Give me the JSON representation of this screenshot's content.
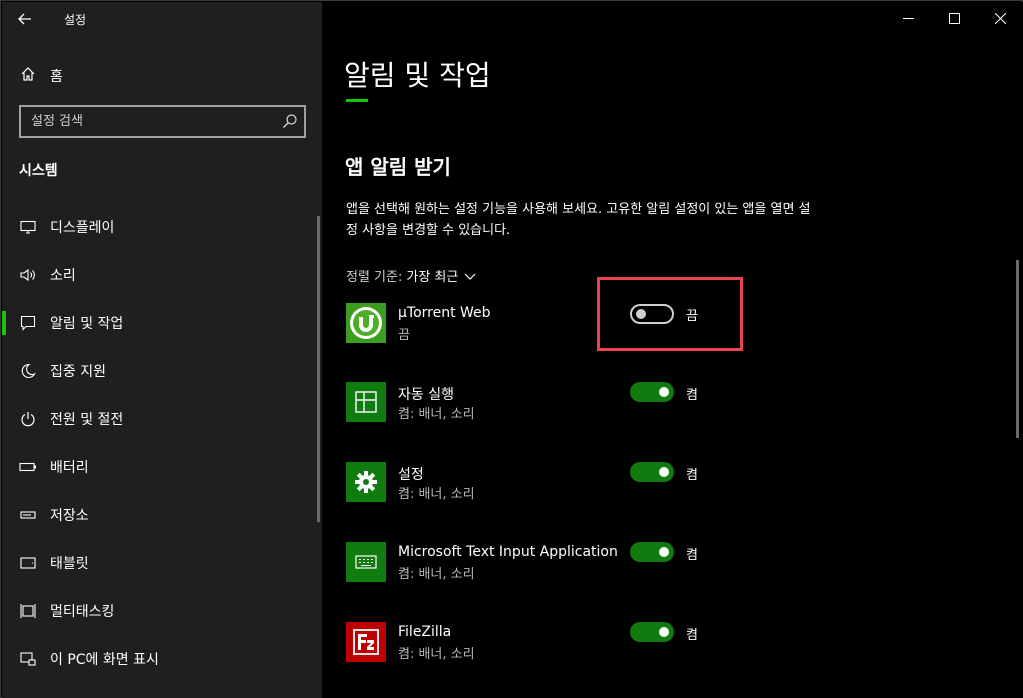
{
  "window": {
    "title": "설정",
    "controls": [
      "minimize",
      "maximize",
      "close"
    ]
  },
  "sidebar": {
    "home_label": "홈",
    "search_placeholder": "설정 검색",
    "section_title": "시스템",
    "items": [
      {
        "label": "디스플레이",
        "icon": "display-icon"
      },
      {
        "label": "소리",
        "icon": "sound-icon"
      },
      {
        "label": "알림 및 작업",
        "icon": "notification-icon",
        "active": true
      },
      {
        "label": "집중 지원",
        "icon": "focus-moon-icon"
      },
      {
        "label": "전원 및 절전",
        "icon": "power-icon"
      },
      {
        "label": "배터리",
        "icon": "battery-icon"
      },
      {
        "label": "저장소",
        "icon": "storage-icon"
      },
      {
        "label": "태블릿",
        "icon": "tablet-icon"
      },
      {
        "label": "멀티태스킹",
        "icon": "multitasking-icon"
      },
      {
        "label": "이 PC에 화면 표시",
        "icon": "project-icon"
      }
    ]
  },
  "main": {
    "page_title": "알림 및 작업",
    "subsection": "앱 알림 받기",
    "description": "앱을 선택해 원하는 설정 기능을 사용해 보세요. 고유한 알림 설정이 있는 앱을 열면 설정 사항을 변경할 수 있습니다.",
    "sort_label": "정렬 기준:",
    "sort_value": "가장 최근",
    "apps": [
      {
        "name": "µTorrent Web",
        "status": "끔",
        "toggle": "끔",
        "on": false,
        "icon": "utorrent-icon"
      },
      {
        "name": "자동 실행",
        "status": "켬: 배너, 소리",
        "toggle": "켬",
        "on": true,
        "icon": "autoplay-icon"
      },
      {
        "name": "설정",
        "status": "켬: 배너, 소리",
        "toggle": "켬",
        "on": true,
        "icon": "settings-gear-icon"
      },
      {
        "name": "Microsoft Text Input Application",
        "status": "켬: 배너, 소리",
        "toggle": "켬",
        "on": true,
        "icon": "keyboard-icon"
      },
      {
        "name": "FileZilla",
        "status": "켬: 배너, 소리",
        "toggle": "켬",
        "on": true,
        "icon": "filezilla-icon"
      }
    ]
  },
  "colors": {
    "accent_green": "#107c10",
    "highlight_red": "#e8434f",
    "sidebar_bg": "#1f1f1f",
    "main_bg": "#000000"
  }
}
